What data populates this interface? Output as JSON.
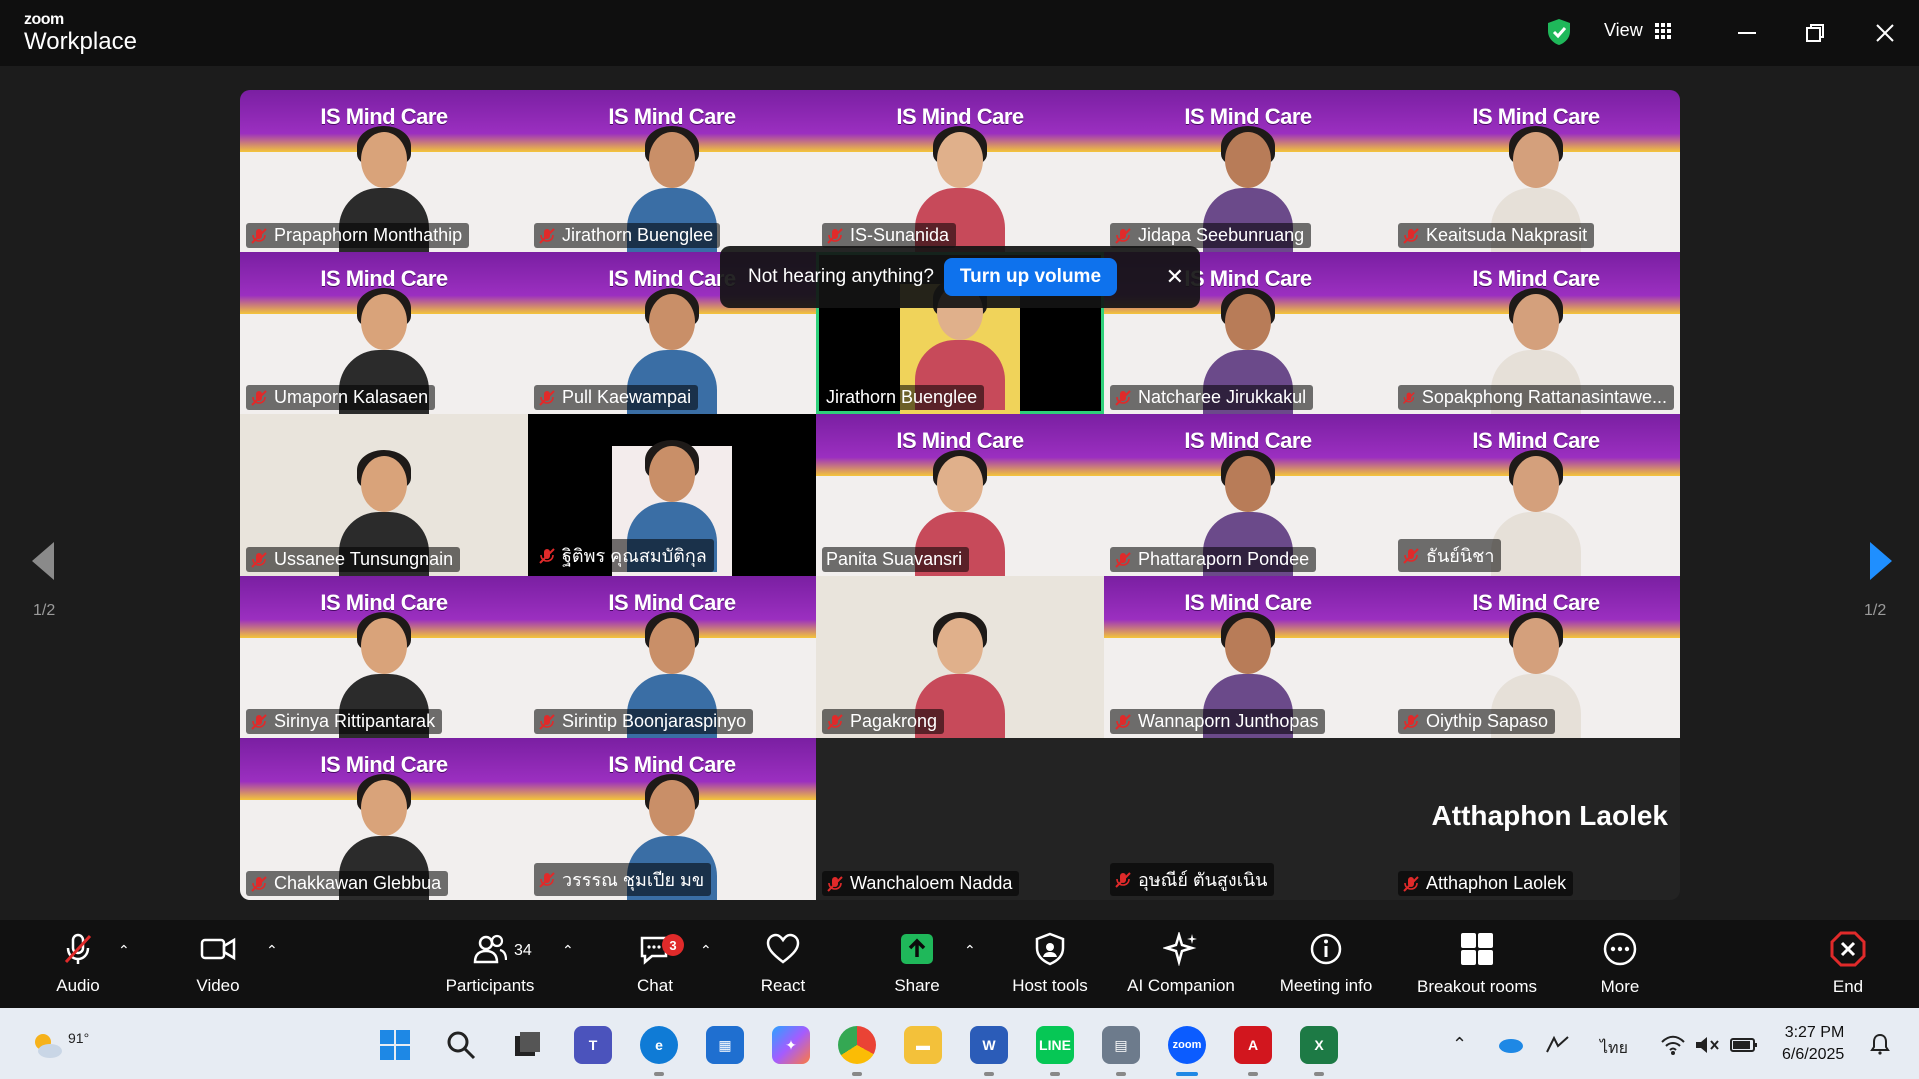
{
  "window": {
    "brand_small": "zoom",
    "brand_big": "Workplace",
    "view_label": "View"
  },
  "toast": {
    "message": "Not hearing anything?",
    "action": "Turn up volume"
  },
  "pager": {
    "left": "1/2",
    "right": "1/2"
  },
  "banner_text": "IS Mind Care",
  "participants": [
    {
      "name": "Prapaphorn Monthathip",
      "muted": true
    },
    {
      "name": "Jirathorn Buenglee",
      "muted": true
    },
    {
      "name": "IS-Sunanida",
      "muted": true
    },
    {
      "name": "Jidapa Seebunruang",
      "muted": true
    },
    {
      "name": "Keaitsuda Nakprasit",
      "muted": true
    },
    {
      "name": "Umaporn Kalasaen",
      "muted": true
    },
    {
      "name": "Pull Kaewampai",
      "muted": true
    },
    {
      "name": "Jirathorn Buenglee",
      "muted": false
    },
    {
      "name": "Natcharee Jirukkakul",
      "muted": true
    },
    {
      "name": "Sopakphong Rattanasintawe...",
      "muted": true
    },
    {
      "name": "Ussanee Tunsungnain",
      "muted": true
    },
    {
      "name": "ฐิติพร คุณสมบัติกุล",
      "muted": true
    },
    {
      "name": "Panita Suavansri",
      "muted": false
    },
    {
      "name": "Phattaraporn Pondee",
      "muted": true
    },
    {
      "name": "ธันย์นิชา",
      "muted": true
    },
    {
      "name": "Sirinya Rittipantarak",
      "muted": true
    },
    {
      "name": "Sirintip Boonjaraspinyo",
      "muted": true
    },
    {
      "name": "Pagakrong",
      "muted": true
    },
    {
      "name": "Wannaporn Junthopas",
      "muted": true
    },
    {
      "name": "Oiythip Sapaso",
      "muted": true
    },
    {
      "name": "Chakkawan Glebbua",
      "muted": true
    },
    {
      "name": "วรรรณ ชุมเปีย มข",
      "muted": true
    },
    {
      "name": "Wanchaloem Nadda",
      "muted": true
    },
    {
      "name": "อุษณีย์ ตันสูงเนิน",
      "muted": true
    },
    {
      "name": "Atthaphon Laolek",
      "muted": true
    }
  ],
  "video_off_name": "Atthaphon Laolek",
  "toolbar": {
    "audio": "Audio",
    "video": "Video",
    "participants": "Participants",
    "participants_count": "34",
    "chat": "Chat",
    "chat_badge": "3",
    "react": "React",
    "share": "Share",
    "host_tools": "Host tools",
    "ai_companion": "AI Companion",
    "meeting_info": "Meeting info",
    "breakout_rooms": "Breakout rooms",
    "more": "More",
    "end": "End"
  },
  "taskbar": {
    "temperature": "91°",
    "language": "ไทย",
    "time": "3:27 PM",
    "date": "6/6/2025"
  },
  "colors": {
    "speaker_outline": "#2fd07a",
    "turn_up_button": "#0e72ed",
    "end_button": "#e02a2a",
    "banner_purple": "#7a1fa2"
  }
}
